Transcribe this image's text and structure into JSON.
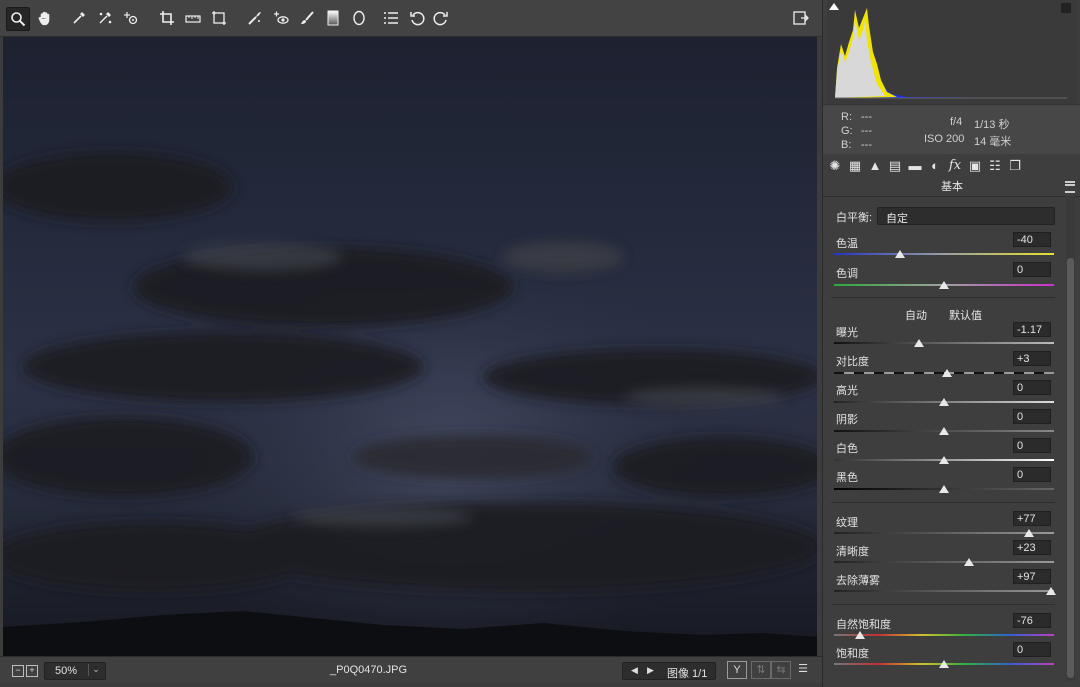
{
  "toolbar": {
    "tools": [
      {
        "name": "zoom-tool",
        "icon": "magnifier-icon",
        "active": true
      },
      {
        "name": "hand-tool",
        "icon": "hand-icon"
      },
      {
        "name": "white-balance-tool",
        "icon": "eyedropper-icon"
      },
      {
        "name": "color-sampler-tool",
        "icon": "color-sampler-icon"
      },
      {
        "name": "targeted-adjustment-tool",
        "icon": "targeted-adjustment-icon"
      },
      {
        "name": "crop-tool",
        "icon": "crop-icon"
      },
      {
        "name": "straighten-tool",
        "icon": "ruler-icon"
      },
      {
        "name": "transform-tool",
        "icon": "transform-icon"
      },
      {
        "name": "spot-removal-tool",
        "icon": "spot-removal-icon"
      },
      {
        "name": "red-eye-tool",
        "icon": "red-eye-icon"
      },
      {
        "name": "adjustment-brush-tool",
        "icon": "brush-icon"
      },
      {
        "name": "graduated-filter-tool",
        "icon": "graduated-filter-icon"
      },
      {
        "name": "radial-filter-tool",
        "icon": "ellipse-icon"
      },
      {
        "name": "preferences-button",
        "icon": "list-icon"
      },
      {
        "name": "rotate-left-button",
        "icon": "rotate-ccw-icon"
      },
      {
        "name": "rotate-right-button",
        "icon": "rotate-cw-icon"
      }
    ],
    "fullscreen_icon": "fullscreen-exit-icon"
  },
  "status": {
    "zoom_value": "50%",
    "filename": "_P0Q0470.JPG",
    "image_counter": "图像 1/1",
    "before_after_label": "Y"
  },
  "info": {
    "r_label": "R:",
    "r_value": "---",
    "g_label": "G:",
    "g_value": "---",
    "b_label": "B:",
    "b_value": "---",
    "aperture": "f/4",
    "shutter": "1/13 秒",
    "iso": "ISO 200",
    "focal": "14 毫米"
  },
  "panel": {
    "section_title": "基本",
    "white_balance_label": "白平衡:",
    "white_balance_value": "自定",
    "auto_label": "自动",
    "default_label": "默认值",
    "sliders": {
      "temperature": {
        "label": "色温",
        "value": "-40",
        "level": 0.3
      },
      "tint": {
        "label": "色调",
        "value": "0",
        "level": 0.5
      },
      "exposure": {
        "label": "曝光",
        "value": "-1.17",
        "level": 0.385
      },
      "contrast": {
        "label": "对比度",
        "value": "+3",
        "level": 0.515
      },
      "highlights": {
        "label": "高光",
        "value": "0",
        "level": 0.5
      },
      "shadows": {
        "label": "阴影",
        "value": "0",
        "level": 0.5
      },
      "whites": {
        "label": "白色",
        "value": "0",
        "level": 0.5
      },
      "blacks": {
        "label": "黑色",
        "value": "0",
        "level": 0.5
      },
      "texture": {
        "label": "纹理",
        "value": "+77",
        "level": 0.885
      },
      "clarity": {
        "label": "清晰度",
        "value": "+23",
        "level": 0.615
      },
      "dehaze": {
        "label": "去除薄雾",
        "value": "+97",
        "level": 0.985
      },
      "vibrance": {
        "label": "自然饱和度",
        "value": "-76",
        "level": 0.12
      },
      "saturation": {
        "label": "饱和度",
        "value": "0",
        "level": 0.5
      }
    }
  },
  "colors": {
    "panel_bg": "#3e3e3e",
    "toolbar_bg": "#434343",
    "field_bg": "#2b2b2b",
    "histogram_yellow": "#f0e400",
    "histogram_blue": "#1a2cff"
  }
}
